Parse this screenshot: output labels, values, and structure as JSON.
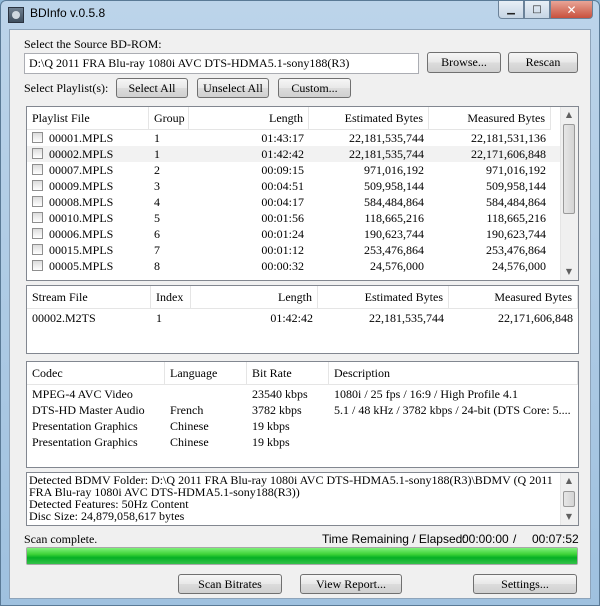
{
  "window": {
    "title": "BDInfo v.0.5.8"
  },
  "source": {
    "label": "Select the Source BD-ROM:",
    "path": "D:\\Q 2011 FRA Blu-ray 1080i AVC DTS-HDMA5.1-sony188(R3)",
    "browse_label": "Browse...",
    "rescan_label": "Rescan"
  },
  "playlist_controls": {
    "label": "Select Playlist(s):",
    "select_all": "Select All",
    "unselect_all": "Unselect All",
    "custom": "Custom..."
  },
  "playlists": {
    "columns": [
      "Playlist File",
      "Group",
      "Length",
      "Estimated Bytes",
      "Measured Bytes"
    ],
    "rows": [
      [
        "00001.MPLS",
        "1",
        "01:43:17",
        "22,181,535,744",
        "22,181,531,136"
      ],
      [
        "00002.MPLS",
        "1",
        "01:42:42",
        "22,181,535,744",
        "22,171,606,848"
      ],
      [
        "00007.MPLS",
        "2",
        "00:09:15",
        "971,016,192",
        "971,016,192"
      ],
      [
        "00009.MPLS",
        "3",
        "00:04:51",
        "509,958,144",
        "509,958,144"
      ],
      [
        "00008.MPLS",
        "4",
        "00:04:17",
        "584,484,864",
        "584,484,864"
      ],
      [
        "00010.MPLS",
        "5",
        "00:01:56",
        "118,665,216",
        "118,665,216"
      ],
      [
        "00006.MPLS",
        "6",
        "00:01:24",
        "190,623,744",
        "190,623,744"
      ],
      [
        "00015.MPLS",
        "7",
        "00:01:12",
        "253,476,864",
        "253,476,864"
      ],
      [
        "00005.MPLS",
        "8",
        "00:00:32",
        "24,576,000",
        "24,576,000"
      ]
    ]
  },
  "streams": {
    "columns": [
      "Stream File",
      "Index",
      "Length",
      "Estimated Bytes",
      "Measured Bytes"
    ],
    "rows": [
      [
        "00002.M2TS",
        "1",
        "01:42:42",
        "22,181,535,744",
        "22,171,606,848"
      ]
    ]
  },
  "codecs": {
    "columns": [
      "Codec",
      "Language",
      "Bit Rate",
      "Description"
    ],
    "rows": [
      [
        "MPEG-4 AVC Video",
        "",
        "23540 kbps",
        "1080i / 25 fps / 16:9 / High Profile 4.1"
      ],
      [
        "DTS-HD Master Audio",
        "French",
        "3782 kbps",
        "5.1 / 48 kHz / 3782 kbps / 24-bit (DTS Core: 5...."
      ],
      [
        "Presentation Graphics",
        "Chinese",
        "19 kbps",
        ""
      ],
      [
        "Presentation Graphics",
        "Chinese",
        "19 kbps",
        ""
      ]
    ]
  },
  "log": {
    "lines": [
      "Detected BDMV Folder: D:\\Q 2011 FRA Blu-ray 1080i AVC DTS-HDMA5.1-sony188(R3)\\BDMV (Q 2011",
      "FRA Blu-ray 1080i AVC DTS-HDMA5.1-sony188(R3))",
      "Detected Features: 50Hz Content",
      "Disc Size: 24,879,058,617 bytes"
    ]
  },
  "status": {
    "text": "Scan complete.",
    "time_label": "Time Remaining / Elapsed:",
    "remaining": "00:00:00",
    "separator": "/",
    "elapsed": "00:07:52",
    "progress": 1.0
  },
  "footer": {
    "scan_bitrates": "Scan Bitrates",
    "view_report": "View Report...",
    "settings": "Settings..."
  },
  "colors": {
    "progress": "#06b025",
    "selected_row": "#f2f2f2"
  }
}
